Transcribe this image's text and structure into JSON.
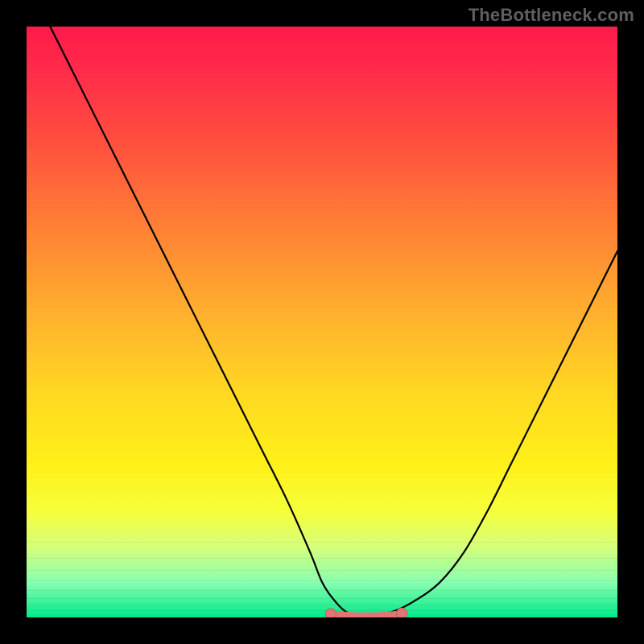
{
  "watermark": "TheBottleneck.com",
  "colors": {
    "curve_stroke": "#000000",
    "marker_fill": "#e57373",
    "marker_stroke": "#cf5a5a"
  },
  "chart_data": {
    "type": "line",
    "title": "",
    "xlabel": "",
    "ylabel": "",
    "xlim": [
      0,
      100
    ],
    "ylim": [
      0,
      100
    ],
    "series": [
      {
        "name": "bottleneck-curve",
        "x": [
          4,
          8,
          12,
          16,
          20,
          24,
          28,
          32,
          36,
          40,
          44,
          48,
          50,
          52,
          54,
          56,
          58,
          62,
          66,
          70,
          74,
          78,
          82,
          86,
          90,
          94,
          98,
          100
        ],
        "y": [
          100,
          92,
          84,
          76,
          68,
          60,
          52,
          44,
          36,
          28,
          20,
          11,
          6,
          3,
          1,
          0.5,
          0.5,
          1,
          3,
          6,
          11,
          18,
          26,
          34,
          42,
          50,
          58,
          62
        ]
      }
    ],
    "markers": {
      "name": "optimal-range",
      "x": [
        51.5,
        53,
        54.5,
        56,
        57.5,
        59,
        60.5,
        62,
        63.5
      ],
      "y": [
        0.6,
        0.5,
        0.4,
        0.3,
        0.3,
        0.3,
        0.4,
        0.5,
        0.7
      ]
    },
    "annotations": []
  }
}
